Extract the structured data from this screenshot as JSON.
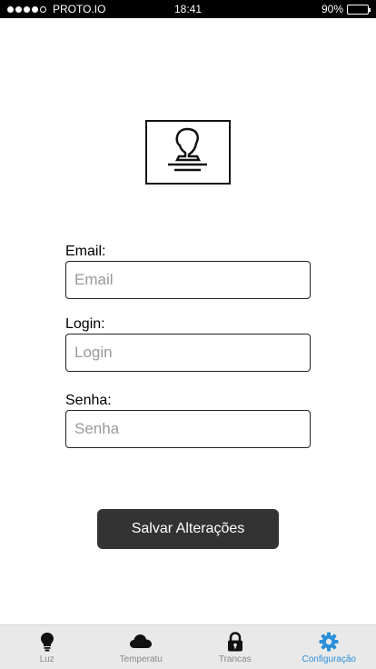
{
  "status_bar": {
    "carrier": "PROTO.IO",
    "time": "18:41",
    "battery_label": "90%",
    "battery_level": 0.9
  },
  "form": {
    "email": {
      "label": "Email:",
      "placeholder": "Email"
    },
    "login": {
      "label": "Login:",
      "placeholder": "Login"
    },
    "password": {
      "label": "Senha:",
      "placeholder": "Senha"
    },
    "save_label": "Salvar Alterações"
  },
  "tabs": [
    {
      "label": "Luz",
      "icon": "lightbulb-icon",
      "active": false
    },
    {
      "label": "Temperatu",
      "icon": "cloud-icon",
      "active": false
    },
    {
      "label": "Trancas",
      "icon": "lock-icon",
      "active": false
    },
    {
      "label": "Configuração",
      "icon": "gear-icon",
      "active": true
    }
  ],
  "colors": {
    "accent": "#2a8fd8",
    "button": "#333333",
    "tab_bar": "#e9e9e9"
  }
}
